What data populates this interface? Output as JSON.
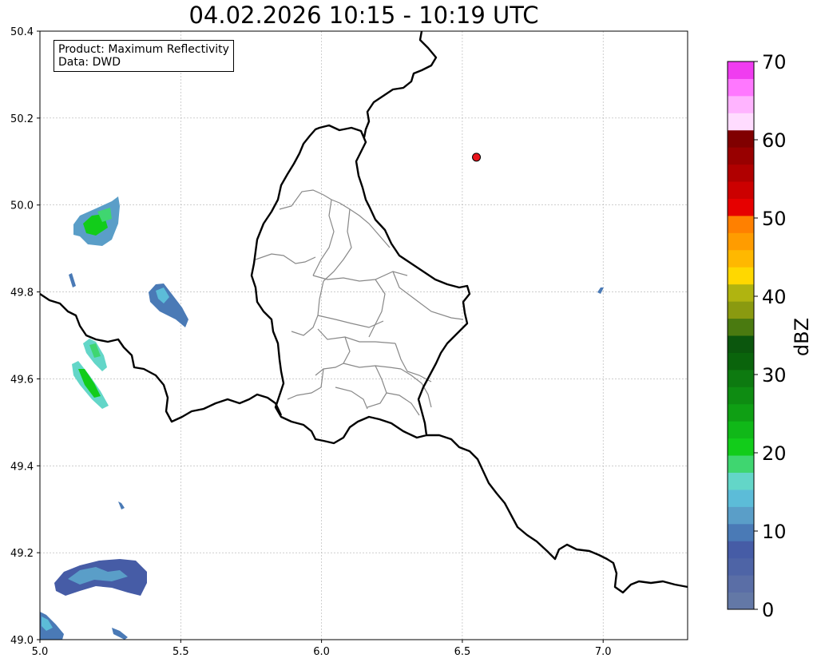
{
  "title": "04.02.2026 10:15 - 10:19 UTC",
  "info_box": {
    "product": "Product: Maximum Reflectivity",
    "source": "Data: DWD"
  },
  "map": {
    "x_ticks": [
      "5.0",
      "5.5",
      "6.0",
      "6.5",
      "7.0"
    ],
    "y_ticks": [
      "49.0",
      "49.2",
      "49.4",
      "49.6",
      "49.8",
      "50.0",
      "50.2",
      "50.4"
    ],
    "lon_range": [
      5.0,
      7.3
    ],
    "lat_range": [
      49.0,
      50.4
    ],
    "grid": true,
    "marker": {
      "lon": 6.55,
      "lat": 50.11,
      "color": "#e8141c"
    }
  },
  "colorbar": {
    "label": "dBZ",
    "ticks": [
      "0",
      "10",
      "20",
      "30",
      "40",
      "50",
      "60",
      "70"
    ],
    "range": [
      0,
      70
    ],
    "colors": [
      "#6378a6",
      "#5a6ea6",
      "#4e64a6",
      "#465ca6",
      "#4a7ab6",
      "#5a9ec8",
      "#5cbcd8",
      "#63d6c8",
      "#3fd670",
      "#12cc1a",
      "#10b818",
      "#0f9f14",
      "#0e8c12",
      "#0d7a10",
      "#0a640c",
      "#0b560d",
      "#4a7a10",
      "#8a9a10",
      "#b0b410",
      "#ffd800",
      "#ffb800",
      "#ff9c00",
      "#ff8000",
      "#e60000",
      "#cc0000",
      "#b00000",
      "#980000",
      "#800000",
      "#ffdcff",
      "#ffb4ff",
      "#ff78ff",
      "#f03cf0"
    ]
  }
}
